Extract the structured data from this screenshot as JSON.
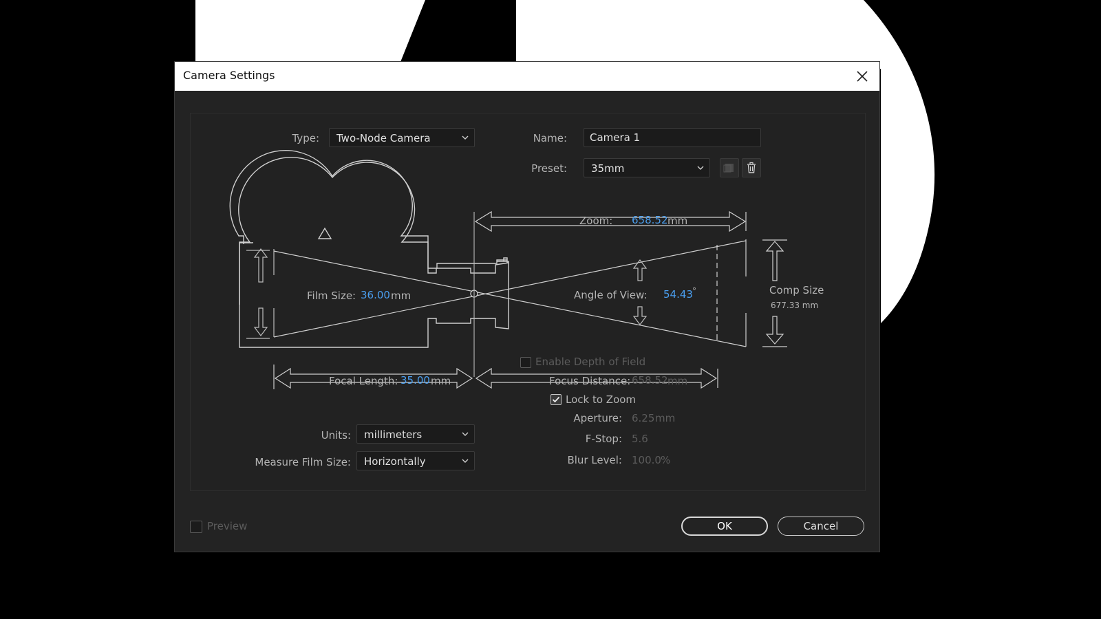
{
  "dialog": {
    "title": "Camera Settings",
    "close_icon": "close-icon"
  },
  "type": {
    "label": "Type:",
    "value": "Two-Node Camera"
  },
  "name": {
    "label": "Name:",
    "value": "Camera 1"
  },
  "preset": {
    "label": "Preset:",
    "value": "35mm",
    "save_icon": "save-preset-icon",
    "delete_icon": "trash-icon"
  },
  "zoom": {
    "label": "Zoom:",
    "value": "658.52",
    "unit": "mm"
  },
  "film_size": {
    "label": "Film Size:",
    "value": "36.00",
    "unit": "mm"
  },
  "angle_of_view": {
    "label": "Angle of View:",
    "value": "54.43",
    "unit": "°"
  },
  "comp_size": {
    "label": "Comp Size",
    "value": "677.33 mm"
  },
  "depth_of_field": {
    "label": "Enable Depth of Field",
    "checked": false
  },
  "focal_length": {
    "label": "Focal Length:",
    "value": "35.00",
    "unit": "mm"
  },
  "focus_distance": {
    "label": "Focus Distance:",
    "value": "658.52",
    "unit": "mm"
  },
  "lock_to_zoom": {
    "label": "Lock to Zoom",
    "checked": true
  },
  "aperture": {
    "label": "Aperture:",
    "value": "6.25",
    "unit": "mm"
  },
  "f_stop": {
    "label": "F-Stop:",
    "value": "5.6"
  },
  "blur_level": {
    "label": "Blur Level:",
    "value": "100.0",
    "unit": "%"
  },
  "units": {
    "label": "Units:",
    "value": "millimeters"
  },
  "measure_film_size": {
    "label": "Measure Film Size:",
    "value": "Horizontally"
  },
  "preview": {
    "label": "Preview",
    "checked": false
  },
  "buttons": {
    "ok": "OK",
    "cancel": "Cancel"
  },
  "colors": {
    "accent": "#4a9ff0",
    "panel": "#232323",
    "titlebar": "#ffffff",
    "line": "#cfcfcf"
  }
}
